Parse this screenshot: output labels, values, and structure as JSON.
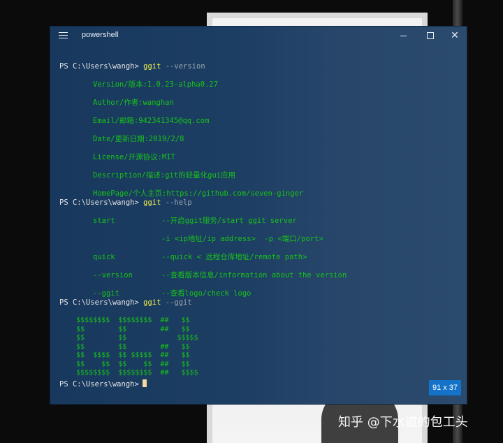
{
  "window": {
    "title": "powershell",
    "minimize_icon": "minimize-icon",
    "maximize_icon": "maximize-icon",
    "close_label": "✕",
    "size_badge": "91 x 37"
  },
  "terminal": {
    "prompt": "PS C:\\Users\\wangh>",
    "block1": {
      "cmd": "ggit",
      "arg": "--version",
      "lines": [
        "Version/版本:1.0.23-alpha0.27",
        "Author/作者:wanghan",
        "Email/邮箱:942341345@qq.com",
        "Date/更新日期:2019/2/8",
        "License/开源协议:MIT",
        "Description/描述:git的轻量化gui应用",
        "HomePage/个人主页:https://github.com/seven-ginger"
      ]
    },
    "block2": {
      "cmd": "ggit",
      "arg": "--help",
      "rows": [
        {
          "opt": "start",
          "desc": "--开启ggit服务/start ggit server"
        },
        {
          "opt": "",
          "desc": "-i <ip地址/ip address>  -p <端口/port>"
        },
        {
          "opt": "quick",
          "desc": "--quick < 远程仓库地址/remote path>"
        },
        {
          "opt": "--version",
          "desc": "--查看版本信息/information about the version"
        },
        {
          "opt": "--ggit",
          "desc": "--查看logo/check logo"
        }
      ]
    },
    "block3": {
      "cmd": "ggit",
      "arg": "--ggit",
      "banner": [
        "$$$$$$$$  $$$$$$$$  ##   $$",
        "$$        $$        ##   $$",
        "$$        $$            $$$$$",
        "$$        $$        ##   $$",
        "$$  $$$$  $$ $$$$$  ##   $$",
        "$$    $$  $$    $$  ##   $$",
        "$$$$$$$$  $$$$$$$$  ##   $$$$"
      ]
    }
  },
  "watermark": "知乎 @下水道的包工头"
}
